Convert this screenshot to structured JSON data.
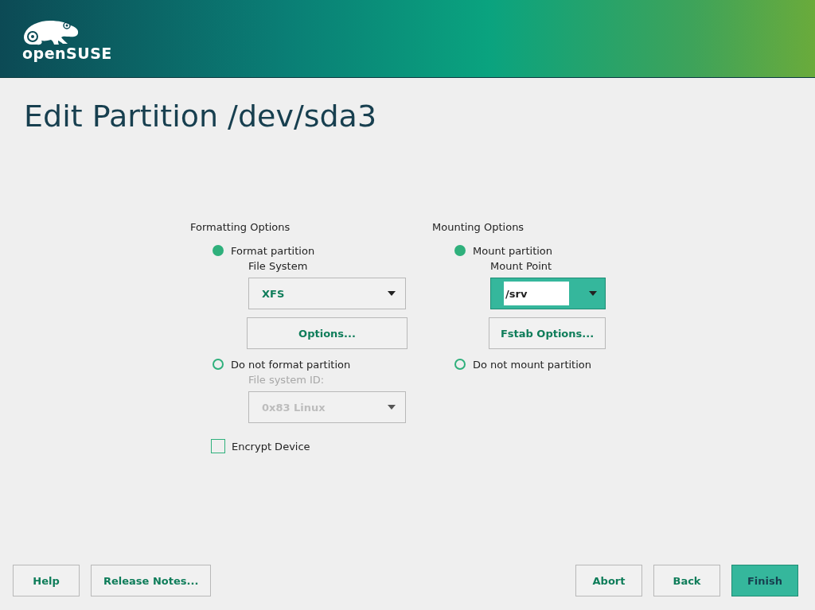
{
  "header": {
    "logo_text": "openSUSE"
  },
  "title": "Edit Partition /dev/sda3",
  "formatting": {
    "heading": "Formatting Options",
    "format_radio": {
      "label": "Format partition",
      "selected": true
    },
    "file_system": {
      "label": "File System",
      "value": "XFS",
      "disabled": false
    },
    "options_button": {
      "label": "Options...",
      "disabled": false
    },
    "no_format_radio": {
      "label": "Do not format partition",
      "selected": false
    },
    "file_system_id": {
      "label": "File system ID:",
      "value": "0x83 Linux",
      "disabled": true
    },
    "encrypt": {
      "label": "Encrypt Device",
      "checked": false
    }
  },
  "mounting": {
    "heading": "Mounting Options",
    "mount_radio": {
      "label": "Mount partition",
      "selected": true
    },
    "mount_point": {
      "label": "Mount Point",
      "value": "/srv",
      "focused": true
    },
    "fstab_button": {
      "label": "Fstab Options..."
    },
    "no_mount_radio": {
      "label": "Do not mount partition",
      "selected": false
    }
  },
  "footer": {
    "left_buttons": [
      {
        "label": "Help",
        "primary": false
      },
      {
        "label": "Release Notes...",
        "primary": false
      }
    ],
    "right_buttons": [
      {
        "label": "Abort",
        "primary": false
      },
      {
        "label": "Back",
        "primary": false
      },
      {
        "label": "Finish",
        "primary": true
      }
    ]
  }
}
